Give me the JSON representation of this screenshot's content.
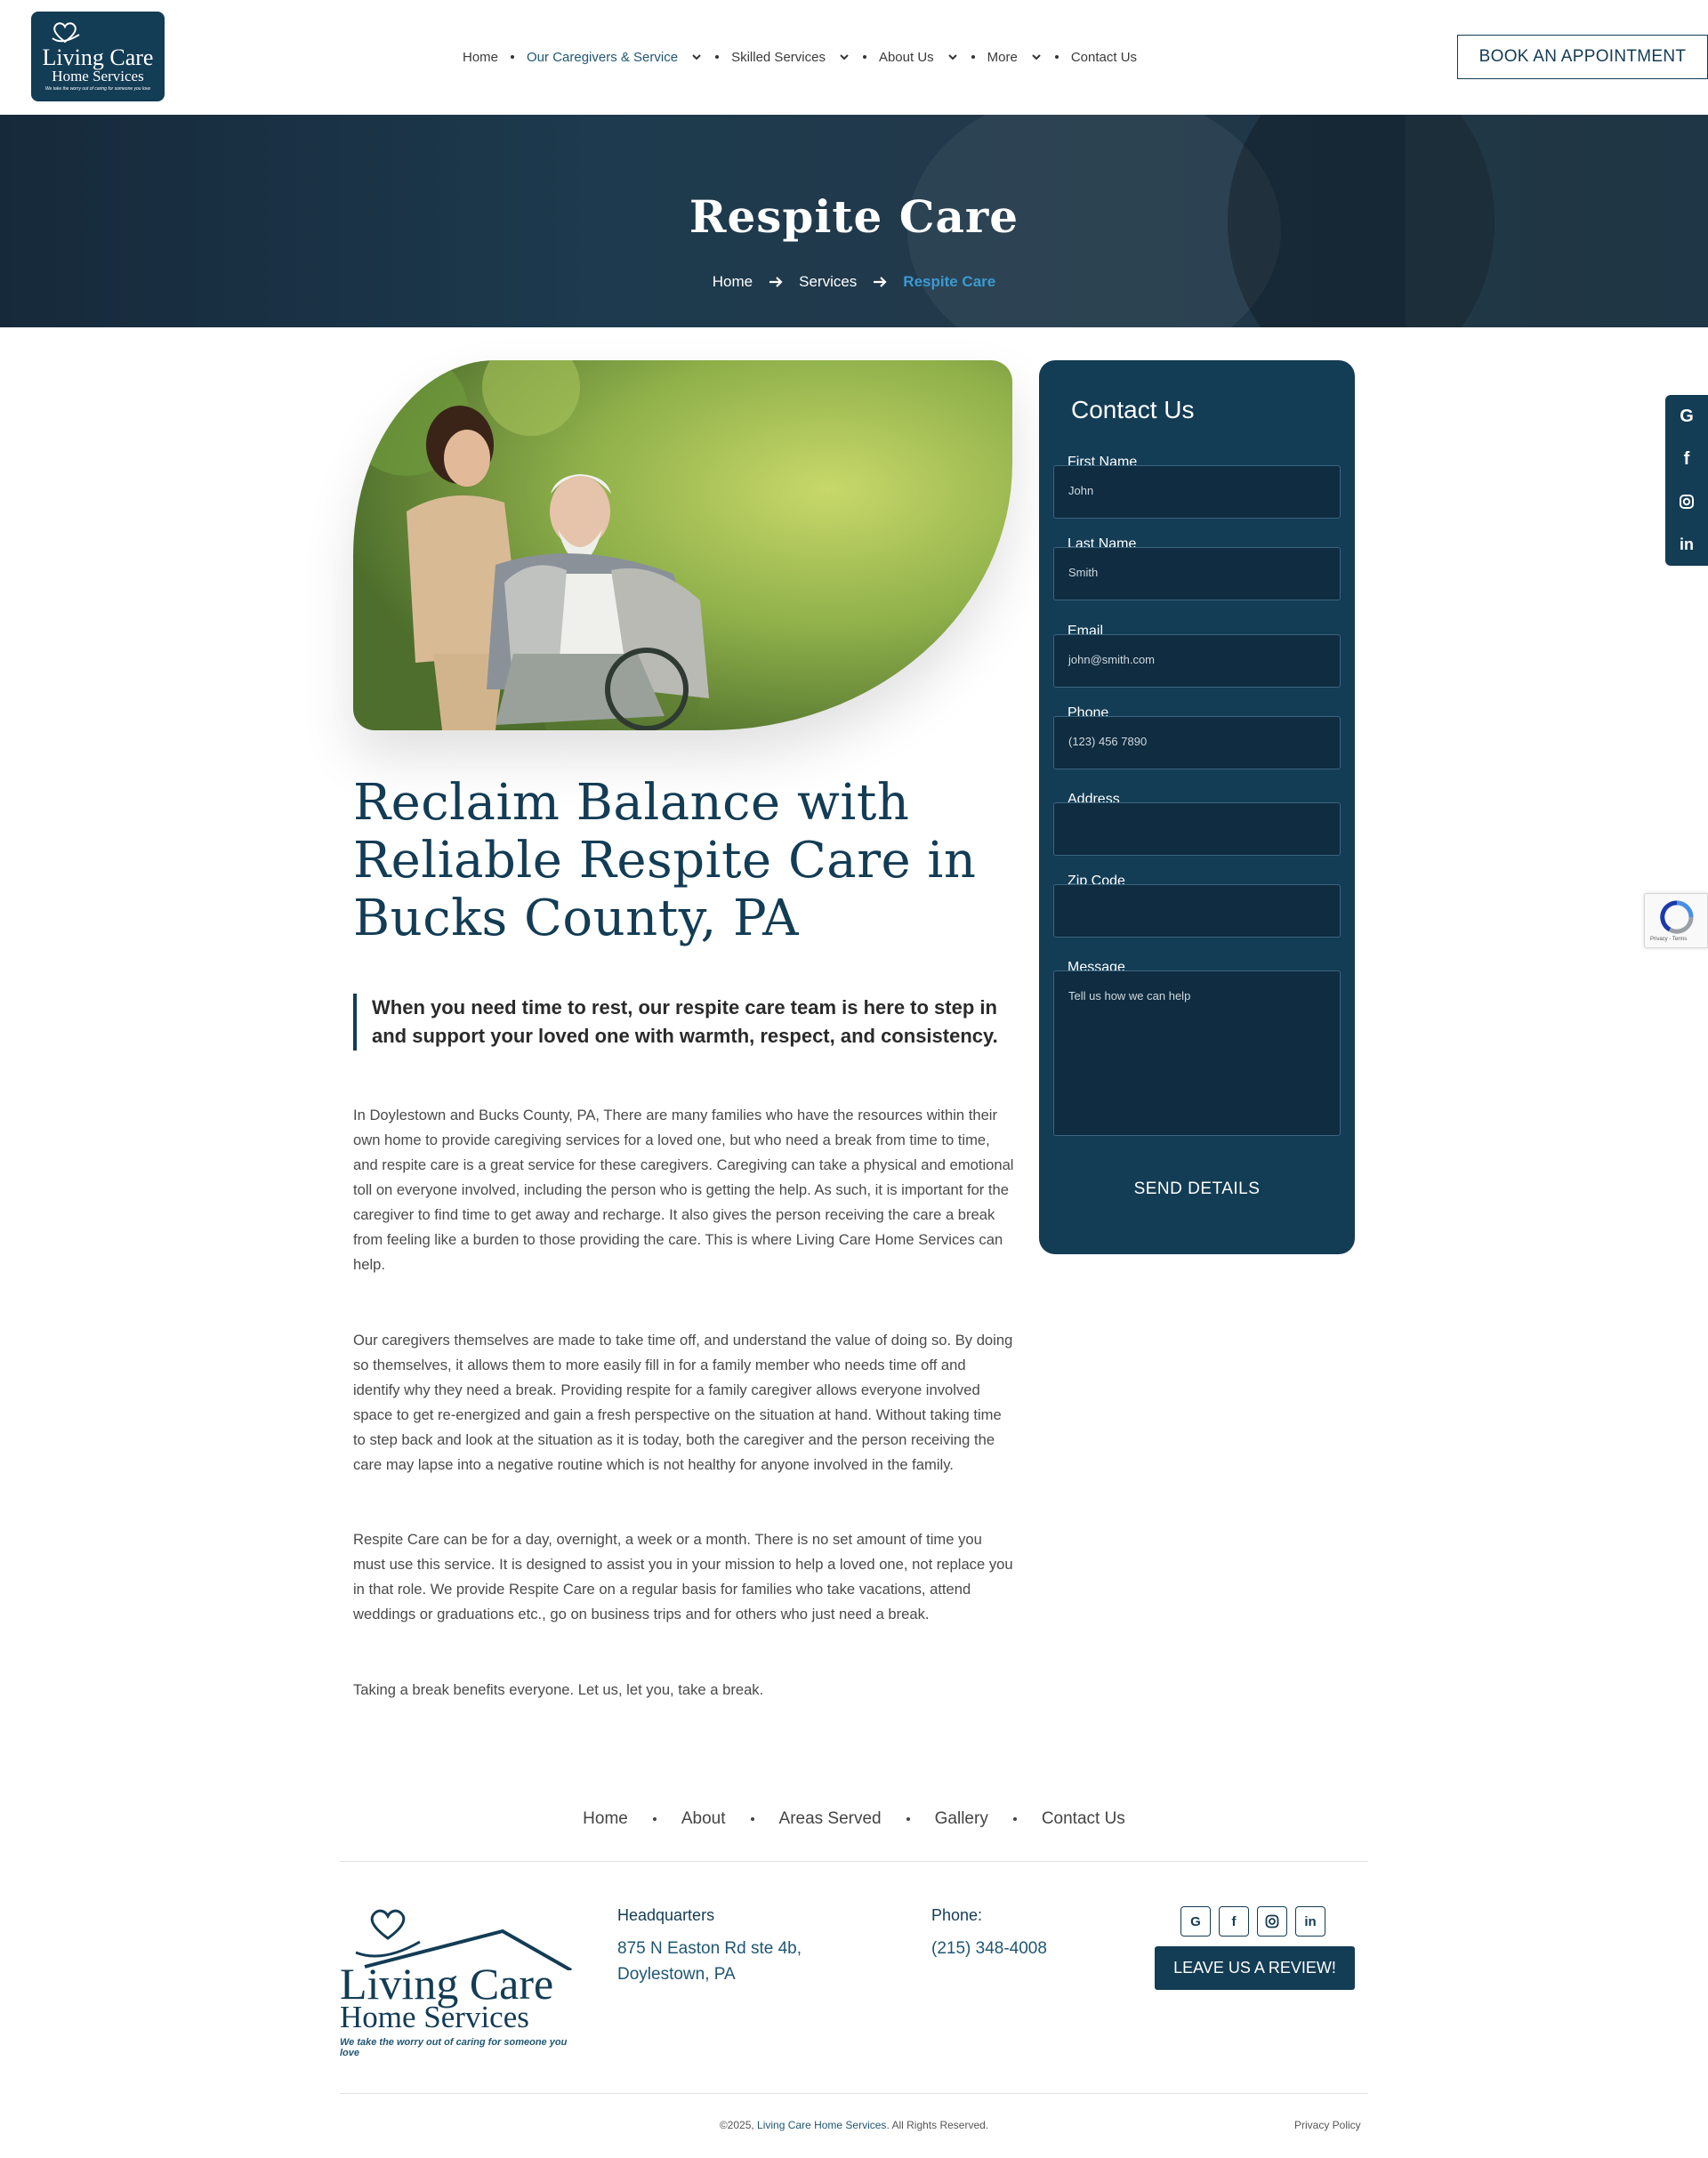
{
  "header": {
    "logo": {
      "line1": "Living Care",
      "line2": "Home Services",
      "tagline": "We take the worry out of caring for someone you love"
    },
    "nav": [
      {
        "label": "Home",
        "dropdown": false,
        "active": false
      },
      {
        "label": "Our Caregivers & Service",
        "dropdown": true,
        "active": true
      },
      {
        "label": "Skilled Services",
        "dropdown": true,
        "active": false
      },
      {
        "label": "About Us",
        "dropdown": true,
        "active": false
      },
      {
        "label": "More",
        "dropdown": true,
        "active": false
      },
      {
        "label": "Contact Us",
        "dropdown": false,
        "active": false
      }
    ],
    "book_label": "BOOK AN APPOINTMENT"
  },
  "hero": {
    "title": "Respite Care",
    "breadcrumb": [
      "Home",
      "Services",
      "Respite Care"
    ]
  },
  "main": {
    "image_alt": "caregiver-with-elderly-man-in-wheelchair",
    "heading": "Reclaim Balance with Reliable Respite Care in Bucks County, PA",
    "quote": "When you need time to rest, our respite care team is here to step in and support your loved one with warmth, respect, and consistency.",
    "paragraphs": [
      "In Doylestown and Bucks County, PA, There are many families who have the resources within their own home to provide caregiving services for a loved one, but who need a break from time to time, and respite care is a great service for these caregivers. Caregiving can take a physical and emotional toll on everyone involved, including the person who is getting the help. As such, it is important for the caregiver to find time to get away and recharge. It also gives the person receiving the care a break from feeling like a burden to those providing the care. This is where Living Care Home Services can help.",
      "Our caregivers themselves are made to take time off, and understand the value of doing so. By doing so themselves, it allows them to more easily fill in for a family member who needs time off and identify why they need a break. Providing respite for a family caregiver allows everyone involved space to get re-energized and gain a fresh perspective on the situation at hand. Without taking time to step back and look at the situation as it is today, both the caregiver and the person receiving the care may lapse into a negative routine which is not healthy for anyone involved in the family.",
      "Respite Care can be for a day, overnight, a week or a month. There is no set amount of time you must use this service. It is designed to assist you in your mission to help a loved one, not replace you in that role. We provide Respite Care on a regular basis for families who take vacations, attend weddings or graduations etc., go on business trips and for others who just need a break.",
      "Taking a break benefits everyone. Let us, let you, take a break."
    ]
  },
  "form": {
    "title": "Contact Us",
    "fields": [
      {
        "label": "First Name",
        "placeholder": "John"
      },
      {
        "label": "Last Name",
        "placeholder": "Smith"
      },
      {
        "label": "Email",
        "placeholder": "john@smith.com"
      },
      {
        "label": "Phone",
        "placeholder": "(123) 456 7890"
      },
      {
        "label": "Address",
        "placeholder": ""
      },
      {
        "label": "Zip Code",
        "placeholder": ""
      },
      {
        "label": "Message",
        "placeholder": "Tell us how we can help"
      }
    ],
    "submit_label": "SEND DETAILS"
  },
  "social_sidebar": [
    "google-icon",
    "facebook-icon",
    "instagram-icon",
    "linkedin-icon"
  ],
  "recaptcha": {
    "text": "Privacy - Terms"
  },
  "footer": {
    "nav": [
      "Home",
      "About",
      "Areas Served",
      "Gallery",
      "Contact Us"
    ],
    "logo": {
      "line1": "Living Care",
      "line2": "Home Services",
      "tagline": "We take the worry out of caring for someone you love"
    },
    "hq_heading": "Headquarters",
    "hq_address_1": "875 N Easton Rd ste 4b,",
    "hq_address_2": "Doylestown, PA",
    "phone_heading": "Phone:",
    "phone": "(215) 348-4008",
    "social": [
      "google-icon",
      "facebook-icon",
      "instagram-icon",
      "linkedin-icon"
    ],
    "review_label": "LEAVE US A REVIEW!",
    "copyright_prefix": "©2025, ",
    "copyright_brand": "Living Care Home Services",
    "copyright_suffix": ". All Rights Reserved.",
    "privacy_label": "Privacy Policy"
  },
  "colors": {
    "brand": "#133c55",
    "accent": "#3b9ad1",
    "link": "#1f5673"
  }
}
